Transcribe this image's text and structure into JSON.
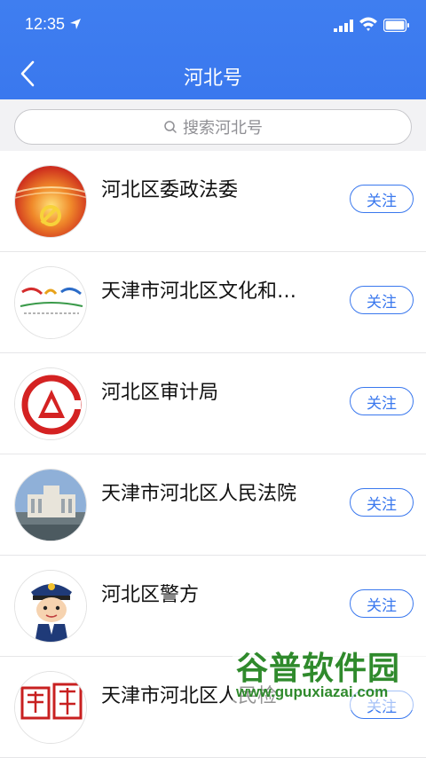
{
  "status_bar": {
    "time": "12:35"
  },
  "nav": {
    "title": "河北号"
  },
  "search": {
    "placeholder": "搜索河北号"
  },
  "items": [
    {
      "title": "河北区委政法委",
      "button": "关注"
    },
    {
      "title": "天津市河北区文化和…",
      "button": "关注"
    },
    {
      "title": "河北区审计局",
      "button": "关注"
    },
    {
      "title": "天津市河北区人民法院",
      "button": "关注"
    },
    {
      "title": "河北区警方",
      "button": "关注"
    },
    {
      "title": "天津市河北区人民检",
      "button": "关注"
    }
  ],
  "watermark": {
    "name": "谷普软件园",
    "url": "www.gupuxiazai.com"
  },
  "colors": {
    "accent": "#3a78ee",
    "divider": "#e6e6e8",
    "search_bg": "#f2f2f4"
  }
}
